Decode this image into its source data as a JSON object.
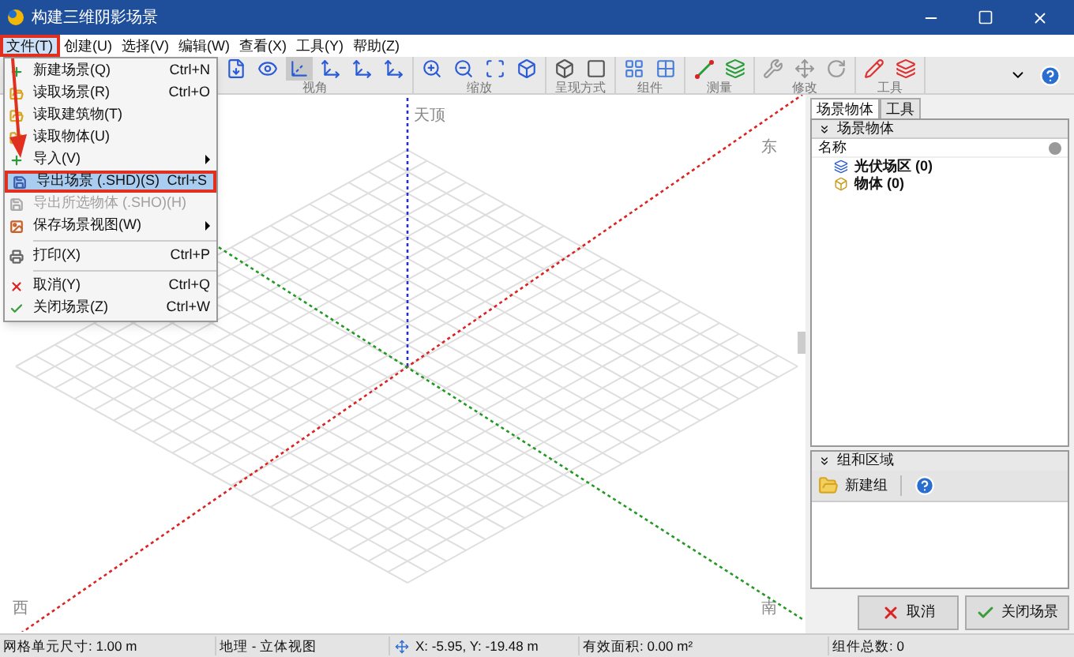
{
  "window": {
    "title": "构建三维阴影场景"
  },
  "menu_bar": [
    {
      "label": "文件(T)",
      "selected": true
    },
    {
      "label": "创建(U)",
      "selected": false
    },
    {
      "label": "选择(V)",
      "selected": false
    },
    {
      "label": "编辑(W)",
      "selected": false
    },
    {
      "label": "查看(X)",
      "selected": false
    },
    {
      "label": "工具(Y)",
      "selected": false
    },
    {
      "label": "帮助(Z)",
      "selected": false
    }
  ],
  "file_menu": [
    {
      "kind": "item",
      "label": "新建场景(Q)",
      "shortcut": "Ctrl+N",
      "selected": false,
      "disabled": false,
      "submenu": false
    },
    {
      "kind": "item",
      "label": "读取场景(R)",
      "shortcut": "Ctrl+O",
      "selected": false,
      "disabled": false,
      "submenu": false
    },
    {
      "kind": "item",
      "label": "读取建筑物(T)",
      "selected": false,
      "disabled": false,
      "submenu": false
    },
    {
      "kind": "item",
      "label": "读取物体(U)",
      "selected": false,
      "disabled": false,
      "submenu": false
    },
    {
      "kind": "item",
      "label": "导入(V)",
      "selected": false,
      "disabled": false,
      "submenu": true
    },
    {
      "kind": "item",
      "label": "导出场景 (.SHD)(S)",
      "shortcut": "Ctrl+S",
      "selected": true,
      "disabled": false,
      "submenu": false
    },
    {
      "kind": "item",
      "label": "导出所选物体 (.SHO)(H)",
      "selected": false,
      "disabled": true,
      "submenu": false
    },
    {
      "kind": "item",
      "label": "保存场景视图(W)",
      "selected": false,
      "disabled": false,
      "submenu": true
    },
    {
      "kind": "separator"
    },
    {
      "kind": "item",
      "label": "打印(X)",
      "shortcut": "Ctrl+P",
      "selected": false,
      "disabled": false,
      "submenu": false
    },
    {
      "kind": "separator"
    },
    {
      "kind": "item",
      "label": "取消(Y)",
      "shortcut": "Ctrl+Q",
      "selected": false,
      "disabled": false,
      "submenu": false
    },
    {
      "kind": "item",
      "label": "关闭场景(Z)",
      "shortcut": "Ctrl+W",
      "selected": false,
      "disabled": false,
      "submenu": false
    }
  ],
  "toolbar": [
    {
      "label": "视角",
      "buttons": [
        {
          "selected": false
        },
        {
          "selected": false
        },
        {
          "selected": true
        },
        {
          "selected": false
        },
        {
          "selected": false
        },
        {
          "selected": false
        }
      ]
    },
    {
      "label": "缩放",
      "buttons": [
        {
          "selected": false
        },
        {
          "selected": false
        },
        {
          "selected": false
        },
        {
          "selected": false
        }
      ]
    },
    {
      "label": "呈现方式",
      "buttons": [
        {
          "selected": false
        },
        {
          "selected": false
        }
      ]
    },
    {
      "label": "组件",
      "buttons": [
        {
          "selected": false
        },
        {
          "selected": false
        }
      ]
    },
    {
      "label": "测量",
      "buttons": [
        {
          "selected": false
        },
        {
          "selected": false
        }
      ]
    },
    {
      "label": "修改",
      "buttons": [
        {
          "selected": false
        },
        {
          "selected": false
        },
        {
          "selected": false
        }
      ]
    },
    {
      "label": "工具",
      "buttons": [
        {
          "selected": false
        },
        {
          "selected": false
        }
      ]
    }
  ],
  "viewport": {
    "labels": {
      "zenith": "天顶",
      "east": "东",
      "west": "西",
      "south": "南"
    }
  },
  "side_panel": {
    "tabs": [
      {
        "label": "场景物体",
        "selected": true
      },
      {
        "label": "工具",
        "selected": false
      }
    ],
    "objects": {
      "title": "场景物体",
      "column": "名称",
      "items": [
        {
          "label": "光伏场区 (0)"
        },
        {
          "label": "物体 (0)"
        }
      ]
    },
    "groups": {
      "title": "组和区域",
      "new_button": "新建组"
    },
    "buttons": {
      "cancel": "取消",
      "close": "关闭场景"
    }
  },
  "status_bar": {
    "grid": "网格单元尺寸: 1.00 m",
    "view": "地理 - 立体视图",
    "coords": "X: -5.95, Y: -19.48 m",
    "area": "有效面积: 0.00 m²",
    "count": "组件总数: 0"
  }
}
